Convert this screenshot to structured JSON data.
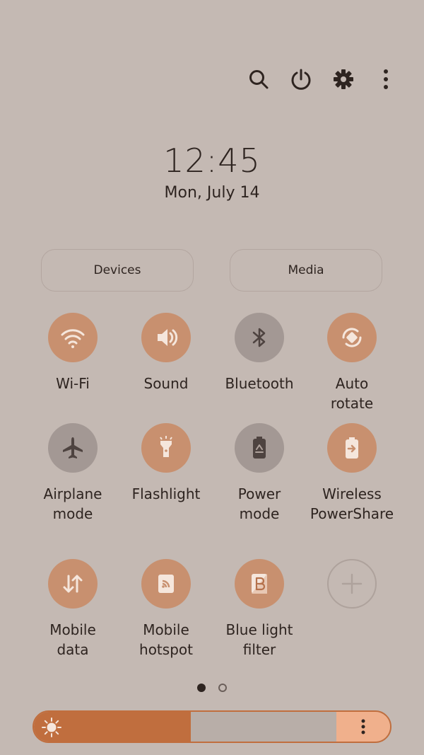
{
  "header": {
    "icons": [
      "search-icon",
      "power-icon",
      "settings-gear-icon",
      "more-vert-icon"
    ]
  },
  "clock": {
    "time": "12:45",
    "date": "Mon, July 14"
  },
  "buttons": {
    "devices": "Devices",
    "media": "Media"
  },
  "tiles": [
    {
      "label": "Wi-Fi",
      "icon": "wifi-icon",
      "state": "on"
    },
    {
      "label": "Sound",
      "icon": "sound-icon",
      "state": "on"
    },
    {
      "label": "Bluetooth",
      "icon": "bluetooth-icon",
      "state": "off"
    },
    {
      "label": "Auto\nrotate",
      "icon": "auto-rotate-icon",
      "state": "on"
    },
    {
      "label": "Airplane\nmode",
      "icon": "airplane-icon",
      "state": "off"
    },
    {
      "label": "Flashlight",
      "icon": "flashlight-icon",
      "state": "on"
    },
    {
      "label": "Power\nmode",
      "icon": "battery-recycle-icon",
      "state": "off"
    },
    {
      "label": "Wireless\nPowerShare",
      "icon": "wireless-powershare-icon",
      "state": "on"
    },
    {
      "label": "Mobile\ndata",
      "icon": "mobile-data-icon",
      "state": "on"
    },
    {
      "label": "Mobile\nhotspot",
      "icon": "hotspot-icon",
      "state": "on"
    },
    {
      "label": "Blue light\nfilter",
      "icon": "blue-light-filter-icon",
      "state": "on"
    }
  ],
  "pager": {
    "page": 1,
    "pages": 2
  },
  "brightness": {
    "level": 0.44
  },
  "colors": {
    "background": "#c4b9b3",
    "tile_on": "#c8906f",
    "tile_off": "#a39894",
    "accent": "#c06e3e"
  }
}
